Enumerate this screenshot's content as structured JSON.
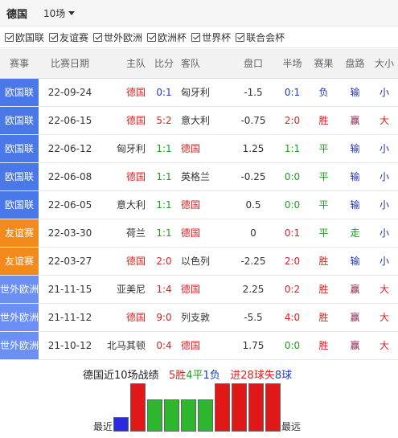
{
  "header": {
    "team": "德国",
    "match_count": "10场"
  },
  "filters": [
    {
      "label": "欧国联",
      "checked": true
    },
    {
      "label": "友谊赛",
      "checked": true
    },
    {
      "label": "世外欧洲",
      "checked": true
    },
    {
      "label": "欧洲杯",
      "checked": true
    },
    {
      "label": "世界杯",
      "checked": true
    },
    {
      "label": "联合会杯",
      "checked": true
    }
  ],
  "columns": [
    "赛事",
    "比赛日期",
    "主队",
    "比分",
    "客队",
    "盘口",
    "半场",
    "赛果",
    "盘路",
    "大小"
  ],
  "matches": [
    {
      "comp": "欧国联",
      "date": "22-09-24",
      "home": "德国",
      "score": "0:1",
      "away": "匈牙利",
      "line": "-1.5",
      "half": "0:1",
      "result": "负",
      "handicap": "输",
      "ou": "小"
    },
    {
      "comp": "欧国联",
      "date": "22-06-15",
      "home": "德国",
      "score": "5:2",
      "away": "意大利",
      "line": "-0.75",
      "half": "2:0",
      "result": "胜",
      "handicap": "赢",
      "ou": "大"
    },
    {
      "comp": "欧国联",
      "date": "22-06-12",
      "home": "匈牙利",
      "score": "1:1",
      "away": "德国",
      "line": "1.25",
      "half": "1:1",
      "result": "平",
      "handicap": "输",
      "ou": "小"
    },
    {
      "comp": "欧国联",
      "date": "22-06-08",
      "home": "德国",
      "score": "1:1",
      "away": "英格兰",
      "line": "-0.25",
      "half": "0:0",
      "result": "平",
      "handicap": "输",
      "ou": "小"
    },
    {
      "comp": "欧国联",
      "date": "22-06-05",
      "home": "意大利",
      "score": "1:1",
      "away": "德国",
      "line": "0.5",
      "half": "0:0",
      "result": "平",
      "handicap": "输",
      "ou": "小"
    },
    {
      "comp": "友谊赛",
      "date": "22-03-30",
      "home": "荷兰",
      "score": "1:1",
      "away": "德国",
      "line": "0",
      "half": "0:1",
      "result": "平",
      "handicap": "走",
      "ou": "小"
    },
    {
      "comp": "友谊赛",
      "date": "22-03-27",
      "home": "德国",
      "score": "2:0",
      "away": "以色列",
      "line": "-2.25",
      "half": "2:0",
      "result": "胜",
      "handicap": "输",
      "ou": "小"
    },
    {
      "comp": "世外欧洲",
      "date": "21-11-15",
      "home": "亚美尼",
      "score": "1:4",
      "away": "德国",
      "line": "2.25",
      "half": "0:2",
      "result": "胜",
      "handicap": "赢",
      "ou": "大"
    },
    {
      "comp": "世外欧洲",
      "date": "21-11-12",
      "home": "德国",
      "score": "9:0",
      "away": "列支敦",
      "line": "-5.5",
      "half": "4:0",
      "result": "胜",
      "handicap": "赢",
      "ou": "大"
    },
    {
      "comp": "世外欧洲",
      "date": "21-10-12",
      "home": "北马其顿",
      "score": "0:4",
      "away": "德国",
      "line": "1.75",
      "half": "0:0",
      "result": "胜",
      "handicap": "赢",
      "ou": "大"
    }
  ],
  "summary": {
    "prefix": "德国近10场战绩",
    "wins_n": "5",
    "wins_l": "胜",
    "draws_n": "4",
    "draws_l": "平",
    "losses_n": "1",
    "losses_l": "负",
    "goals_pre": "进",
    "goals_for": "28",
    "goals_mid": "球失",
    "goals_against": "8",
    "goals_post": "球"
  },
  "form_chart": {
    "recent_label": "最近",
    "oldest_label": "最远",
    "results_recent_first": [
      "负",
      "胜",
      "平",
      "平",
      "平",
      "平",
      "胜",
      "胜",
      "胜",
      "胜"
    ],
    "colors": {
      "win": "#e01818",
      "draw": "#2fb62f",
      "loss": "#2a2ae0"
    }
  },
  "colors": {
    "win": "#e02020",
    "draw": "#1e9e1e",
    "loss": "#1a3cc8",
    "comp_euro": "#4a78e8",
    "comp_friendly": "#f38a1c",
    "comp_wc": "#6b8ff5"
  }
}
